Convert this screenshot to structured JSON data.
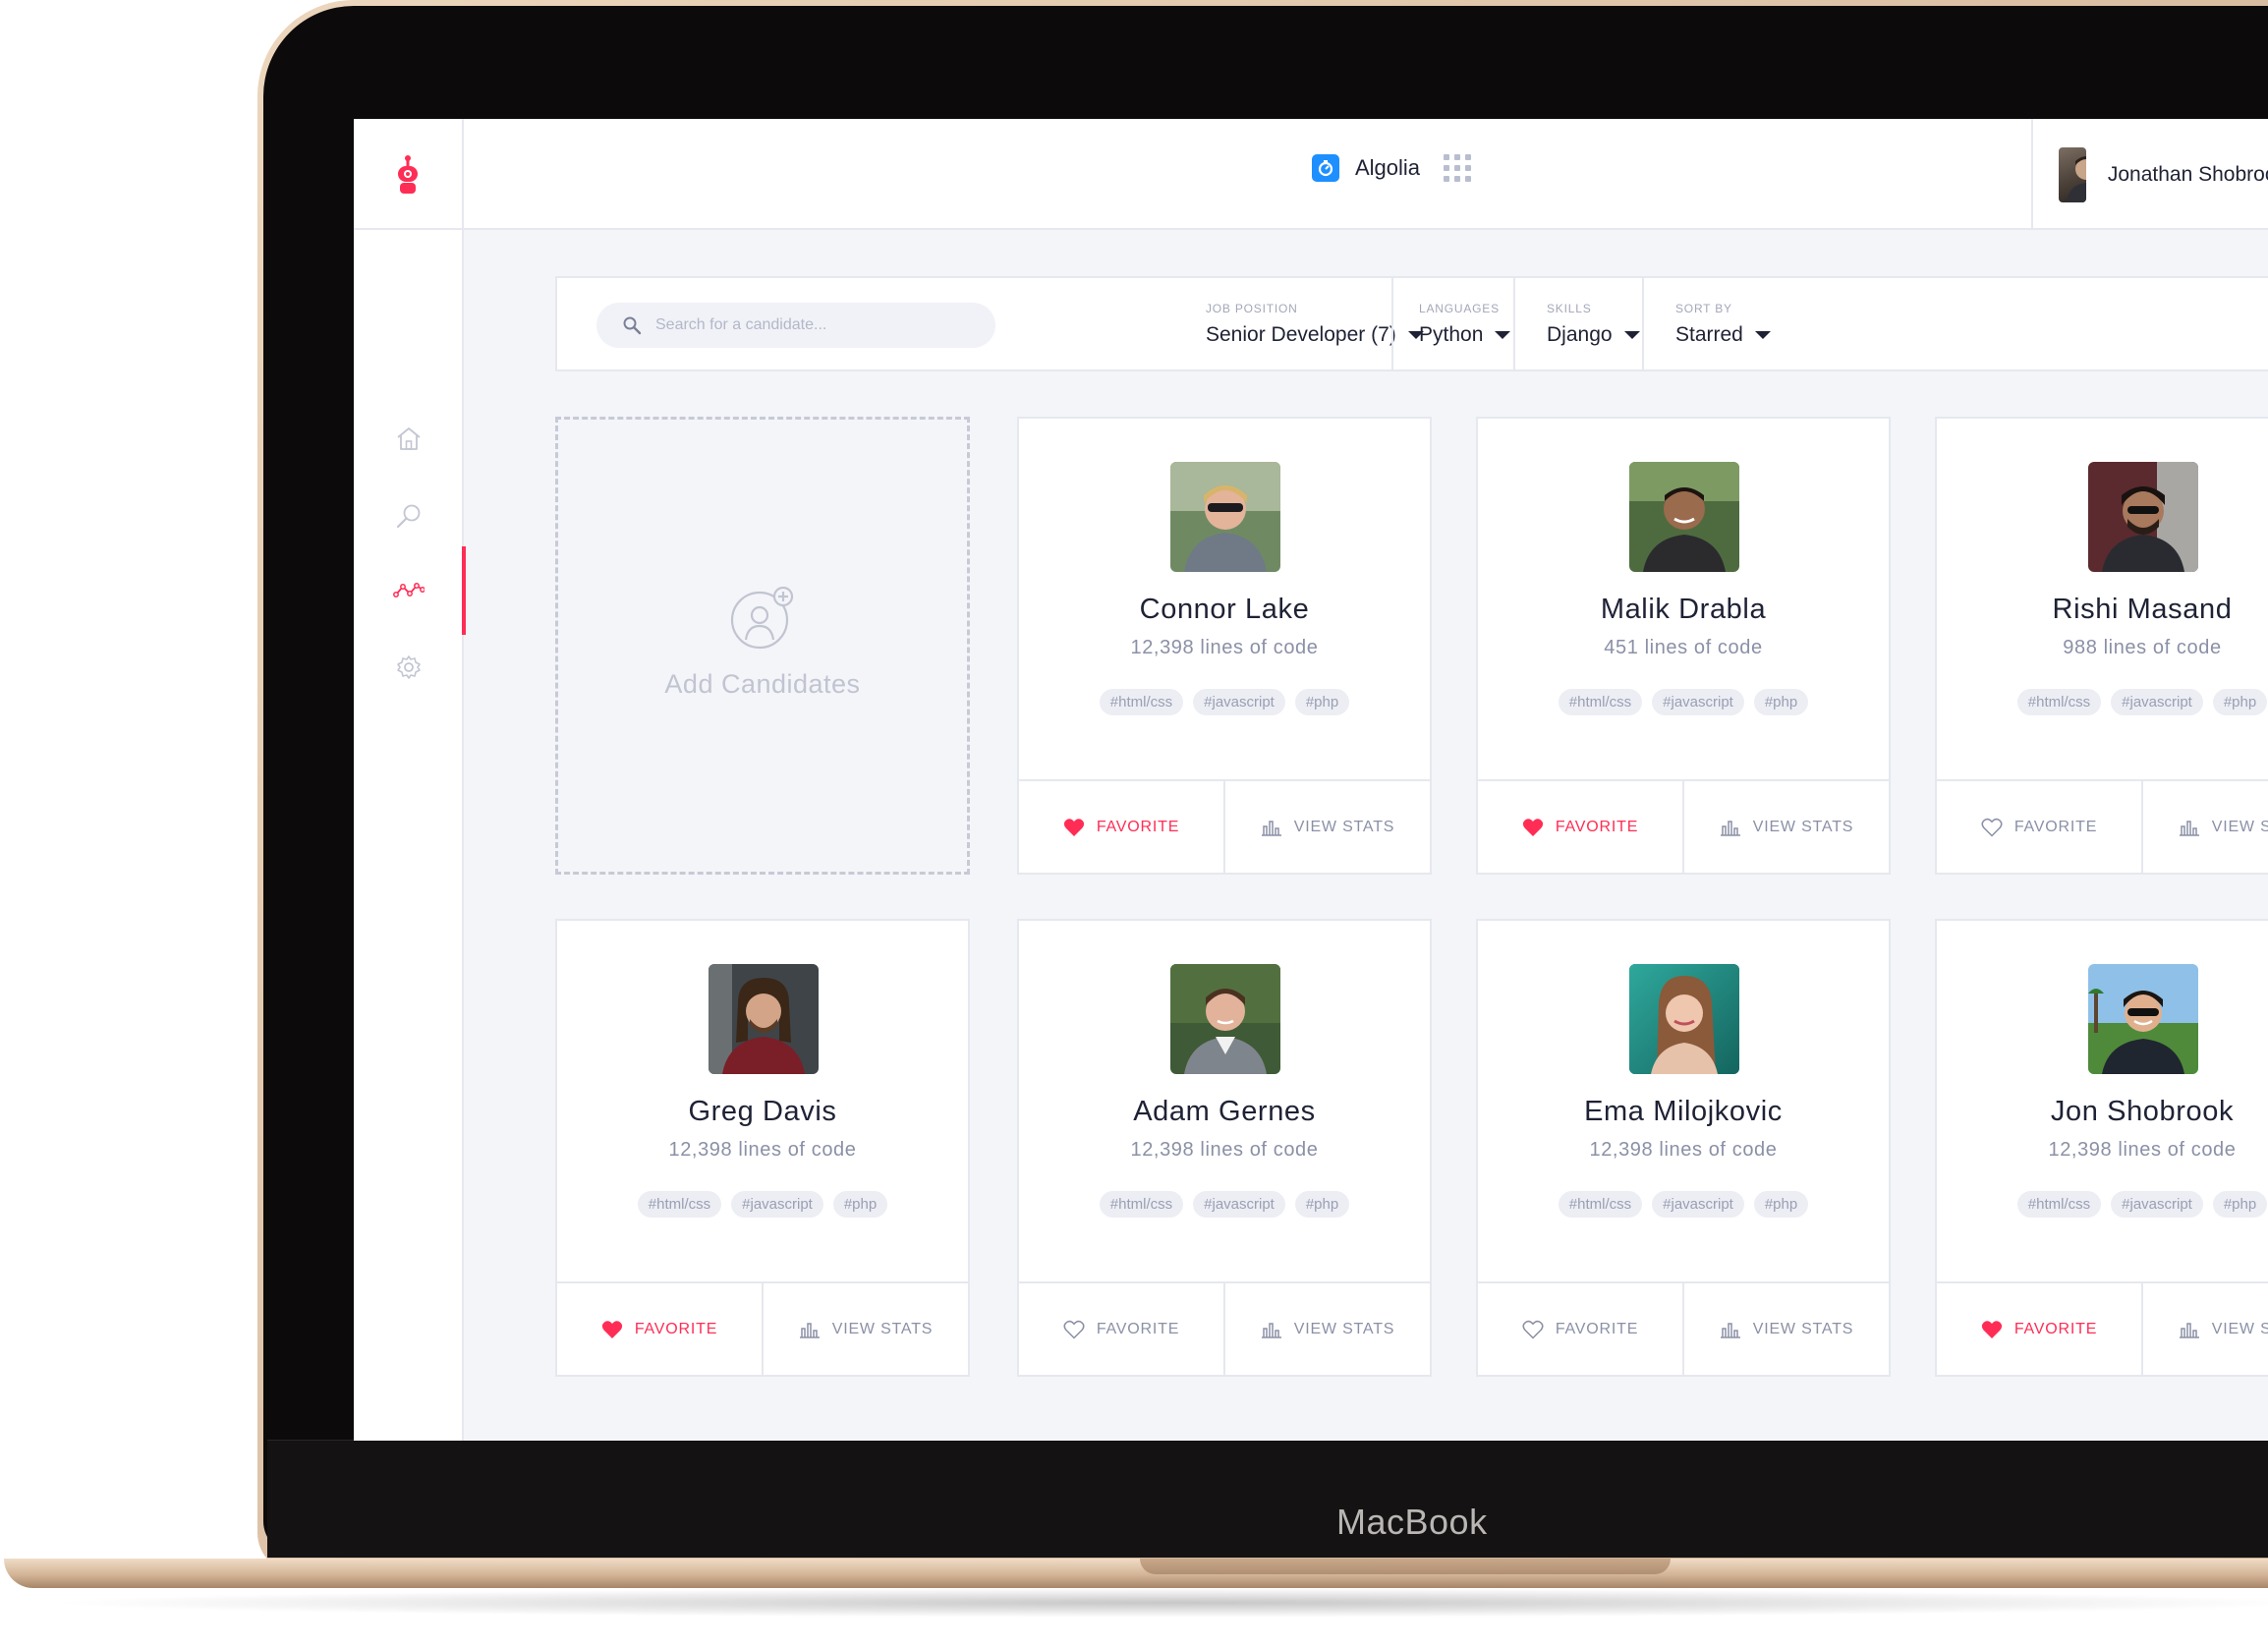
{
  "device": {
    "brand": "MacBook"
  },
  "header": {
    "org_name": "Algolia",
    "user_name": "Jonathan Shobrook",
    "icons": [
      "robot-logo-icon",
      "algolia-icon",
      "apps-grid-icon"
    ]
  },
  "sidebar": {
    "items": [
      {
        "name": "home",
        "icon": "home-icon",
        "active": false
      },
      {
        "name": "search",
        "icon": "search-icon",
        "active": false
      },
      {
        "name": "analytics",
        "icon": "analytics-icon",
        "active": true
      },
      {
        "name": "settings",
        "icon": "gear-icon",
        "active": false
      }
    ]
  },
  "search": {
    "placeholder": "Search for a candidate..."
  },
  "filters": [
    {
      "label": "Job Position",
      "value": "Senior Developer (7)"
    },
    {
      "label": "Languages",
      "value": "Python"
    },
    {
      "label": "Skills",
      "value": "Django"
    },
    {
      "label": "Sort By",
      "value": "Starred"
    }
  ],
  "add_card": {
    "label": "Add Candidates"
  },
  "actions": {
    "favorite": "Favorite",
    "view_stats": "View Stats"
  },
  "candidates": [
    {
      "name": "Connor Lake",
      "lines": "12,398 lines of code",
      "tags": [
        "#html/css",
        "#javascript",
        "#php"
      ],
      "favorite": true
    },
    {
      "name": "Malik Drabla",
      "lines": "451 lines of code",
      "tags": [
        "#html/css",
        "#javascript",
        "#php"
      ],
      "favorite": true
    },
    {
      "name": "Rishi Masand",
      "lines": "988 lines of code",
      "tags": [
        "#html/css",
        "#javascript",
        "#php"
      ],
      "favorite": false
    },
    {
      "name": "Greg Davis",
      "lines": "12,398 lines of code",
      "tags": [
        "#html/css",
        "#javascript",
        "#php"
      ],
      "favorite": true
    },
    {
      "name": "Adam Gernes",
      "lines": "12,398 lines of code",
      "tags": [
        "#html/css",
        "#javascript",
        "#php"
      ],
      "favorite": false
    },
    {
      "name": "Ema Milojkovic",
      "lines": "12,398 lines of code",
      "tags": [
        "#html/css",
        "#javascript",
        "#php"
      ],
      "favorite": false
    },
    {
      "name": "Jon Shobrook",
      "lines": "12,398 lines of code",
      "tags": [
        "#html/css",
        "#javascript",
        "#php"
      ],
      "favorite": true
    }
  ],
  "colors": {
    "accent": "#ff2d55",
    "text": "#1f2235",
    "muted": "#8b90a6",
    "background": "#f4f5f9"
  }
}
